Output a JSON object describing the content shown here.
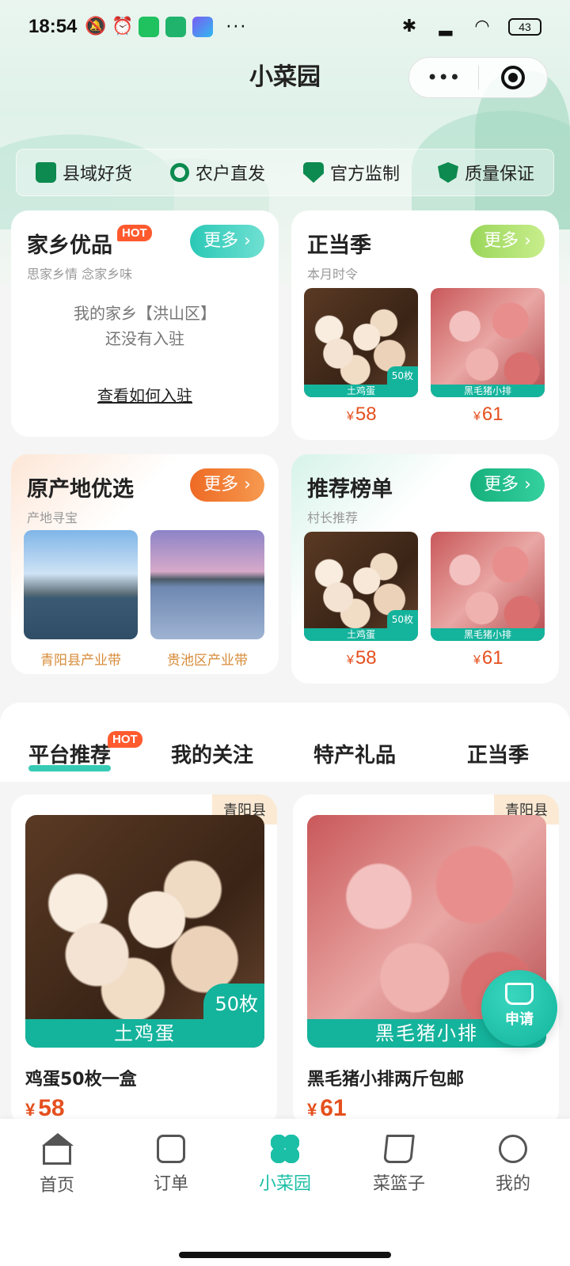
{
  "status_bar": {
    "time": "18:54",
    "battery": "43",
    "dots": "···"
  },
  "title_bar": {
    "title": "小菜园",
    "menu_label": "•••"
  },
  "features": [
    "县域好货",
    "农户直发",
    "官方监制",
    "质量保证"
  ],
  "hometown": {
    "title": "家乡优品",
    "hot": "HOT",
    "subtitle": "思家乡情 念家乡味",
    "more": "更多",
    "empty_line1": "我的家乡【洪山区】",
    "empty_line2": "还没有入驻",
    "link": "查看如何入驻"
  },
  "season": {
    "title": "正当季",
    "subtitle": "本月时令",
    "more": "更多",
    "items": [
      {
        "tag": "土鸡蛋",
        "count": "50枚",
        "currency": "¥",
        "price": "58"
      },
      {
        "tag": "黑毛猪小排",
        "currency": "¥",
        "price": "61"
      }
    ]
  },
  "origin": {
    "title": "原产地优选",
    "subtitle": "产地寻宝",
    "more": "更多",
    "items": [
      {
        "caption": "青阳县产业带"
      },
      {
        "caption": "贵池区产业带"
      }
    ]
  },
  "ranking": {
    "title": "推荐榜单",
    "subtitle": "村长推荐",
    "more": "更多",
    "items": [
      {
        "tag": "土鸡蛋",
        "count": "50枚",
        "currency": "¥",
        "price": "58"
      },
      {
        "tag": "黑毛猪小排",
        "currency": "¥",
        "price": "61"
      }
    ]
  },
  "tabs": {
    "items": [
      "平台推荐",
      "我的关注",
      "特产礼品",
      "正当季"
    ],
    "hot": "HOT",
    "active": 0
  },
  "products": [
    {
      "region": "青阳县",
      "banner": "土鸡蛋",
      "count": "50枚",
      "name": "鸡蛋50枚一盒",
      "currency": "¥",
      "price": "58"
    },
    {
      "region": "青阳县",
      "banner": "黑毛猪小排",
      "name": "黑毛猪小排两斤包邮",
      "currency": "¥",
      "price": "61"
    }
  ],
  "apply_button": {
    "label": "申请"
  },
  "bottom_nav": {
    "items": [
      "首页",
      "订单",
      "小菜园",
      "菜篮子",
      "我的"
    ],
    "active": 2
  },
  "colors": {
    "accent": "#14b39c",
    "price": "#e5501f",
    "hot": "#ff5a2e",
    "more_hometown": "#3fd2c2",
    "more_season": "#a6dd6a",
    "more_origin": "#f07a2a",
    "more_ranking": "#1fbf8c"
  }
}
